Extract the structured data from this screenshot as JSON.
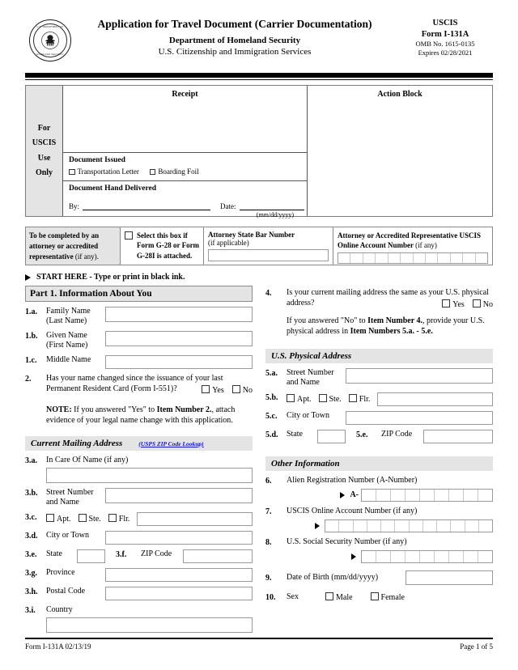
{
  "header": {
    "seal_alt": "dhs-seal",
    "seal_text_top": "U.S. DEPARTMENT OF",
    "seal_text_bottom": "HOMELAND SECURITY",
    "title": "Application for Travel Document (Carrier Documentation)",
    "subtitle1": "Department of Homeland Security",
    "subtitle2": "U.S. Citizenship and Immigration Services",
    "agency": "USCIS",
    "form_number": "Form I-131A",
    "omb": "OMB No. 1615-0135",
    "expires": "Expires 02/28/2021"
  },
  "uscis_use": {
    "side_lines": [
      "For",
      "USCIS",
      "Use",
      "Only"
    ],
    "receipt_label": "Receipt",
    "action_block_label": "Action Block",
    "document_issued_label": "Document Issued",
    "document_issued_options": [
      "Transportation Letter",
      "Boarding Foil"
    ],
    "document_hand_delivered_label": "Document Hand Delivered",
    "by_label": "By:",
    "date_label": "Date:",
    "date_format": "(mm/dd/yyyy)"
  },
  "attorney": {
    "completed_by_bold": "To be completed by an attorney or accredited representative",
    "completed_by_thin": "(if any).",
    "select_box_label": "Select this box if Form G-28 or Form G-28I is attached.",
    "bar_number_label": "Attorney State Bar Number",
    "bar_number_note": "(if applicable)",
    "bar_number_value": "",
    "online_account_label": "Attorney or Accredited Representative USCIS Online Account Number",
    "online_account_note": "(if any)",
    "online_account_cells": 12
  },
  "start_here": "START HERE  -  Type or print in black ink.",
  "part1": {
    "heading": "Part 1.  Information About You",
    "items": [
      {
        "num": "1.a.",
        "label_line1": "Family Name",
        "label_line2": "(Last Name)",
        "value": ""
      },
      {
        "num": "1.b.",
        "label_line1": "Given Name",
        "label_line2": "(First Name)",
        "value": ""
      },
      {
        "num": "1.c.",
        "label_line1": "Middle Name",
        "label_line2": "",
        "value": ""
      }
    ],
    "q2_num": "2.",
    "q2_text": "Has your name changed since the issuance of your last Permanent Resident Card (Form I-551)?",
    "q2_yes": "Yes",
    "q2_no": "No",
    "note_bold": "NOTE:",
    "note_text": " If you answered \"Yes\" to ",
    "note_bold2": "Item Number 2.",
    "note_text2": ", attach evidence of your legal name change with this application."
  },
  "mailing_address": {
    "heading": "Current Mailing Address",
    "usps_link": "(USPS ZIP Code Lookup)",
    "items": [
      {
        "num": "3.a.",
        "label": "In Care Of Name (if any)",
        "value": ""
      },
      {
        "num": "3.b.",
        "label_line1": "Street Number",
        "label_line2": "and Name",
        "value": ""
      },
      {
        "num": "3.c.",
        "checkboxes": [
          "Apt.",
          "Ste.",
          "Flr."
        ],
        "value": ""
      },
      {
        "num": "3.d.",
        "label": "City or Town",
        "value": ""
      },
      {
        "num": "3.e.",
        "label": "State",
        "value": "",
        "num2": "3.f.",
        "label2": "ZIP Code",
        "value2": ""
      },
      {
        "num": "3.g.",
        "label": "Province",
        "value": ""
      },
      {
        "num": "3.h.",
        "label": "Postal Code",
        "value": ""
      },
      {
        "num": "3.i.",
        "label": "Country",
        "value": ""
      }
    ]
  },
  "q4": {
    "num": "4.",
    "text": "Is your current mailing address the same as your U.S. physical address?",
    "yes": "Yes",
    "no": "No",
    "followup_a": "If you answered \"No\" to ",
    "followup_bold": "Item Number 4.",
    "followup_b": ", provide your U.S. physical address in ",
    "followup_bold2": "Item Numbers 5.a. - 5.e."
  },
  "physical_address": {
    "heading": "U.S. Physical Address",
    "items": [
      {
        "num": "5.a.",
        "label_line1": "Street Number",
        "label_line2": "and Name",
        "value": ""
      },
      {
        "num": "5.b.",
        "checkboxes": [
          "Apt.",
          "Ste.",
          "Flr."
        ],
        "value": ""
      },
      {
        "num": "5.c.",
        "label": "City or Town",
        "value": ""
      },
      {
        "num": "5.d.",
        "label": "State",
        "value": "",
        "num2": "5.e.",
        "label2": "ZIP Code",
        "value2": ""
      }
    ]
  },
  "other_information": {
    "heading": "Other Information",
    "item6": {
      "num": "6.",
      "label": "Alien Registration Number (A-Number)",
      "prefix": "A-",
      "cells": 9,
      "value": ""
    },
    "item7": {
      "num": "7.",
      "label": "USCIS Online Account Number (if any)",
      "cells": 12,
      "value": ""
    },
    "item8": {
      "num": "8.",
      "label": "U.S. Social Security Number (if any)",
      "cells": 9,
      "value": ""
    },
    "item9": {
      "num": "9.",
      "label": "Date of Birth (mm/dd/yyyy)",
      "value": ""
    },
    "item10": {
      "num": "10.",
      "label": "Sex",
      "options": [
        "Male",
        "Female"
      ]
    }
  },
  "footer": {
    "left": "Form I-131A   02/13/19",
    "right": "Page 1 of 5"
  },
  "colors": {
    "shade": "#e4e4e4",
    "link": "#1414c8",
    "border": "#999999",
    "rule": "#000000"
  }
}
